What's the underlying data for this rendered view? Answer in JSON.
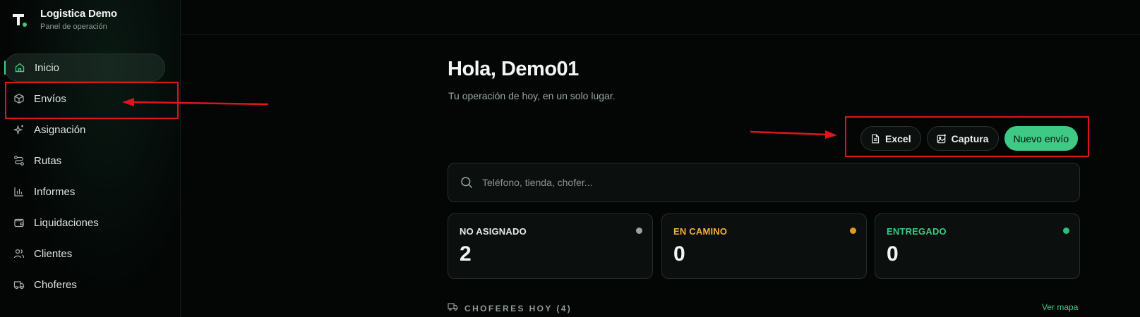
{
  "app": {
    "title": "Logistica Demo",
    "subtitle": "Panel de operación"
  },
  "sidebar": {
    "items": [
      {
        "label": "Inicio",
        "icon": "home-icon",
        "active": true
      },
      {
        "label": "Envíos",
        "icon": "package-icon",
        "active": false
      },
      {
        "label": "Asignación",
        "icon": "sparkles-icon",
        "active": false
      },
      {
        "label": "Rutas",
        "icon": "route-icon",
        "active": false
      },
      {
        "label": "Informes",
        "icon": "bar-chart-icon",
        "active": false
      },
      {
        "label": "Liquidaciones",
        "icon": "wallet-icon",
        "active": false
      },
      {
        "label": "Clientes",
        "icon": "users-icon",
        "active": false
      },
      {
        "label": "Choferes",
        "icon": "truck-icon",
        "active": false
      }
    ]
  },
  "main": {
    "greeting": "Hola, Demo01",
    "subtitle": "Tu operación de hoy, en un solo lugar.",
    "actions": {
      "excel": "Excel",
      "capture": "Captura",
      "new_shipment": "Nuevo envío"
    },
    "search": {
      "placeholder": "Teléfono, tienda, chofer..."
    },
    "stats": [
      {
        "label": "NO ASIGNADO",
        "value": "2",
        "color": "#e6ebe8",
        "dot": "#9aa39f"
      },
      {
        "label": "EN CAMINO",
        "value": "0",
        "color": "#f2b13a",
        "dot": "#e59a1c"
      },
      {
        "label": "ENTREGADO",
        "value": "0",
        "color": "#3ec985",
        "dot": "#2fbf7c"
      }
    ],
    "drivers_section": {
      "title": "CHOFERES HOY (4)",
      "link": "Ver mapa"
    }
  },
  "colors": {
    "accent": "#3ec985",
    "annotation": "#e0141b",
    "background": "#030605"
  }
}
